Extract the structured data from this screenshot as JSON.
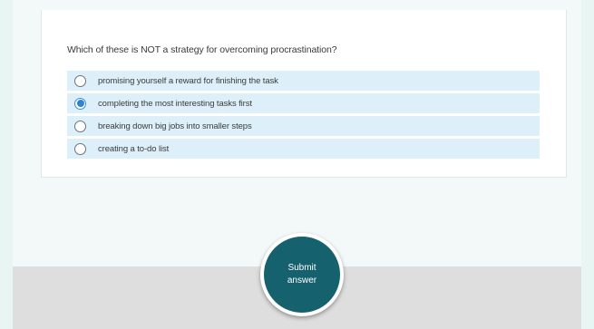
{
  "quiz": {
    "question": "Which of these is NOT a strategy for overcoming procrastination?",
    "options": [
      {
        "label": "promising yourself a reward for finishing the task",
        "selected": false
      },
      {
        "label": "completing the most interesting tasks first",
        "selected": true
      },
      {
        "label": "breaking down big jobs into smaller steps",
        "selected": false
      },
      {
        "label": "creating a to-do list",
        "selected": false
      }
    ]
  },
  "submit": {
    "line1": "Submit",
    "line2": "answer"
  },
  "colors": {
    "option_background": "#ddf0fa",
    "submit_button": "#15616e",
    "radio_selected": "#2f83d4",
    "footer_band": "#dedede"
  }
}
